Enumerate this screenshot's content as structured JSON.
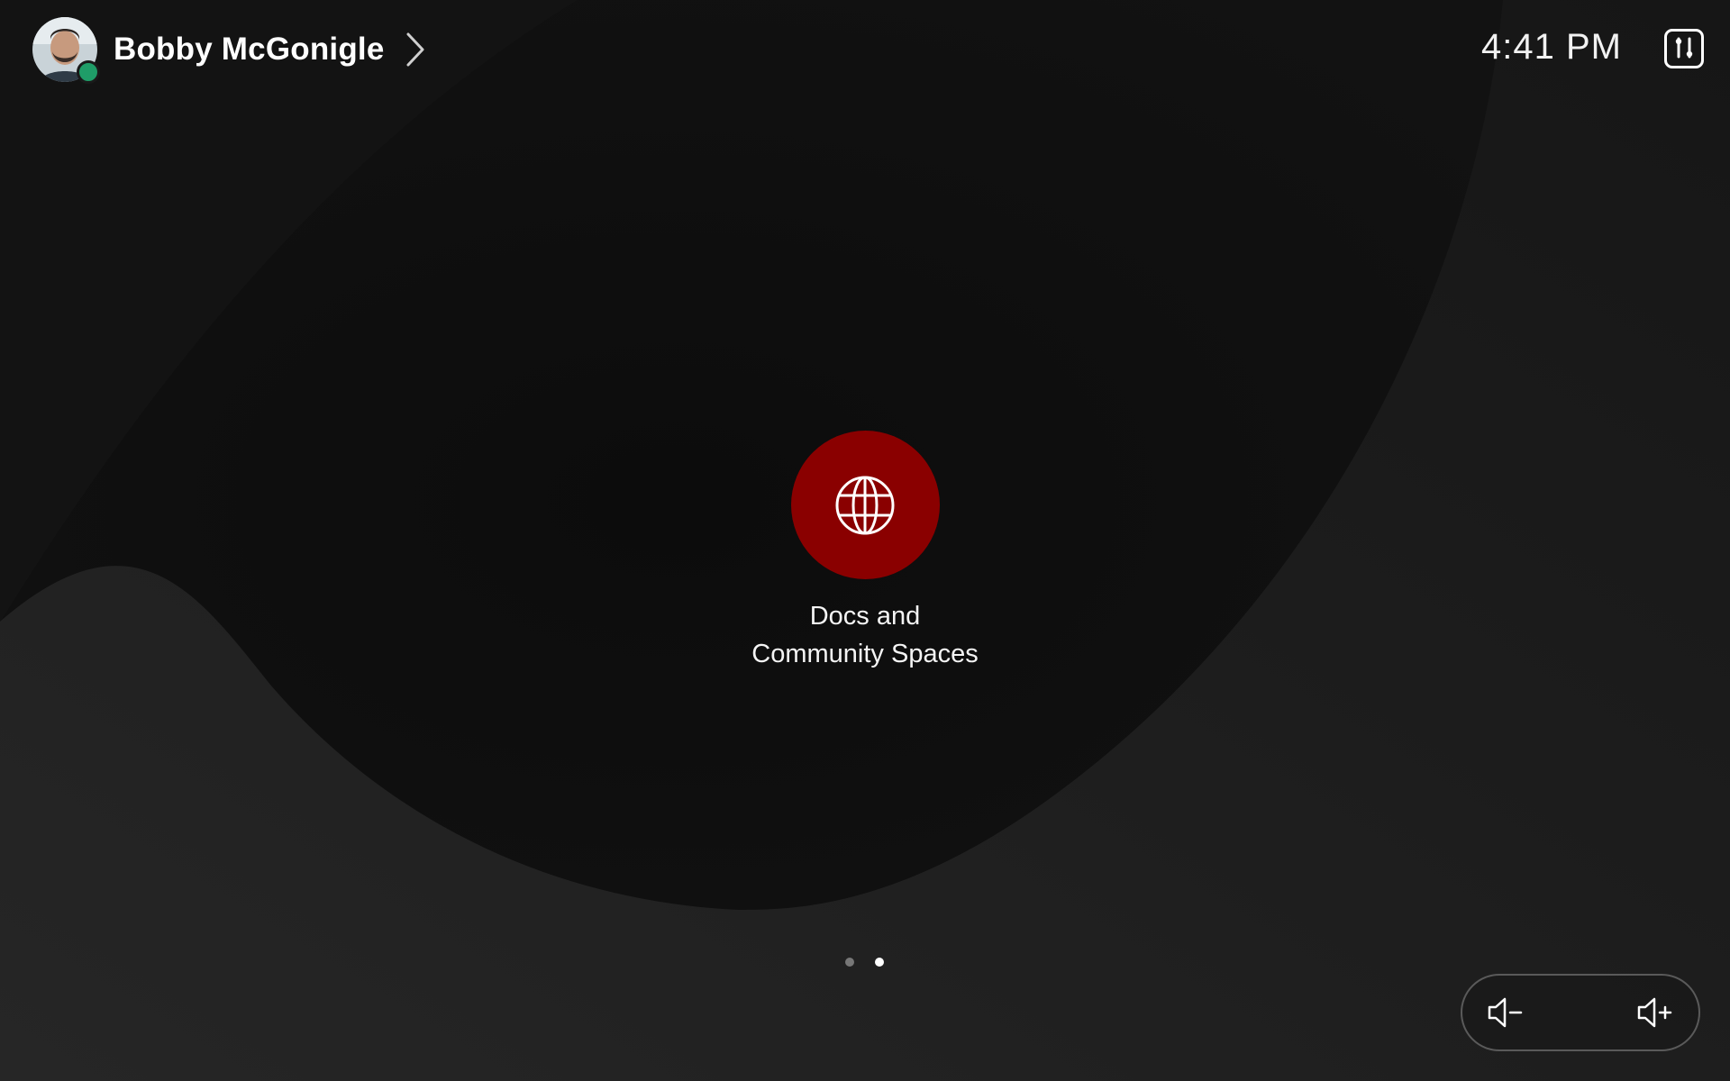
{
  "header": {
    "user_name": "Bobby McGonigle",
    "presence_color": "#1f9d68",
    "time": "4:41 PM",
    "settings_icon": "sliders-icon"
  },
  "tiles": [
    {
      "label_line1": "Docs and",
      "label_line2": "Community Spaces",
      "icon": "globe-icon",
      "color": "#8a0000"
    }
  ],
  "pager": {
    "page_count": 2,
    "current_page": 2
  },
  "volume": {
    "down_icon": "volume-down-icon",
    "up_icon": "volume-up-icon"
  },
  "colors": {
    "background": "#1a1a1a",
    "accent_tile": "#8a0000"
  }
}
